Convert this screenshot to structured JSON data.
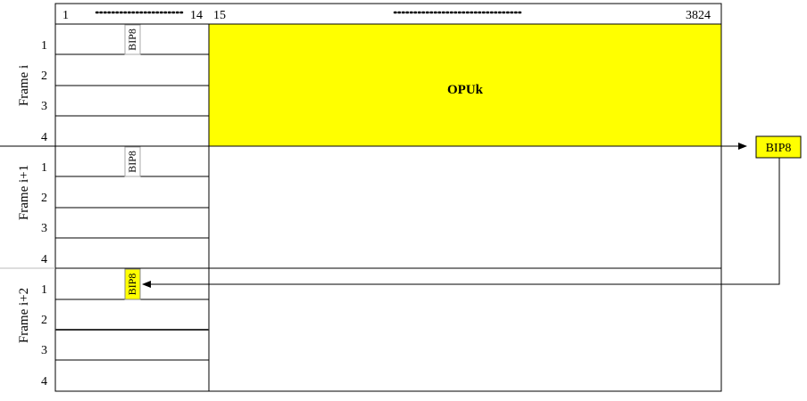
{
  "header": {
    "col_start": "1",
    "col_overhead_end": "14",
    "col_payload_start": "15",
    "col_end": "3824"
  },
  "frames": [
    {
      "label": "Frame i",
      "rows": [
        "1",
        "2",
        "3",
        "4"
      ]
    },
    {
      "label": "Frame i+1",
      "rows": [
        "1",
        "2",
        "3",
        "4"
      ]
    },
    {
      "label": "Frame i+2",
      "rows": [
        "1",
        "2",
        "3",
        "4"
      ]
    }
  ],
  "payload": {
    "label": "OPUk",
    "color": "#ffff00"
  },
  "bip8": {
    "label": "BIP8",
    "computed_label": "BIP8",
    "highlight_color": "#ffff00"
  }
}
